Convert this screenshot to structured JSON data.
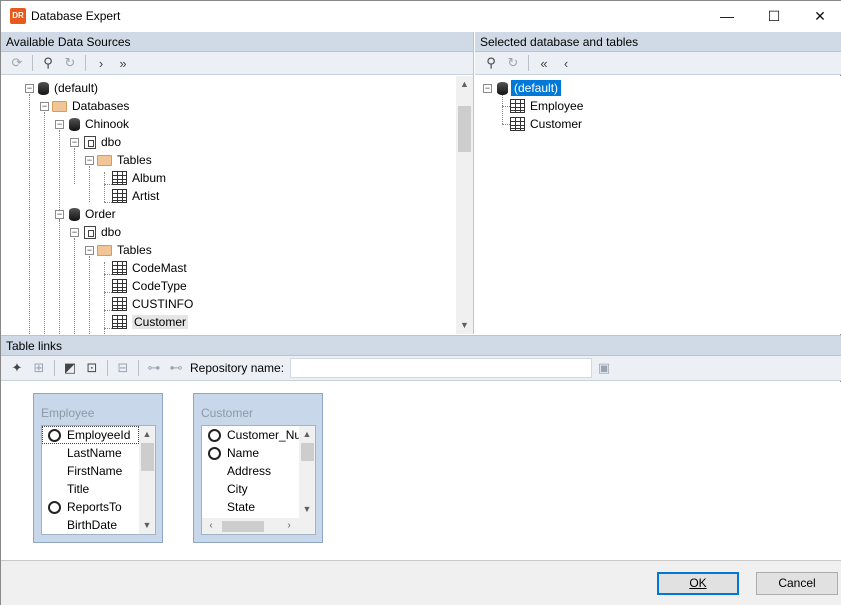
{
  "window": {
    "title": "Database Expert",
    "app_icon_text": "DR",
    "minimize_glyph": "—",
    "maximize_glyph": "☐",
    "close_glyph": "✕"
  },
  "available_pane": {
    "header": "Available Data Sources",
    "toolbar_icons": [
      "refresh-icon",
      "find-icon",
      "find-next-icon",
      "add-icon",
      "add-all-icon"
    ],
    "tree": {
      "root": "(default)",
      "databases": "Databases",
      "db1": "Chinook",
      "db1_schema": "dbo",
      "db1_tables": "Tables",
      "db1_table_1": "Album",
      "db1_table_2": "Artist",
      "db2": "Order",
      "db2_schema": "dbo",
      "db2_tables": "Tables",
      "db2_table_1": "CodeMast",
      "db2_table_2": "CodeType",
      "db2_table_3": "CUSTINFO",
      "db2_table_4": "Customer"
    }
  },
  "selected_pane": {
    "header": "Selected database and tables",
    "toolbar_icons": [
      "find-icon",
      "find-next-icon",
      "remove-all-icon",
      "remove-icon"
    ],
    "tree": {
      "root": "(default)",
      "table_1": "Employee",
      "table_2": "Customer"
    }
  },
  "links_pane": {
    "header": "Table links",
    "repository_label": "Repository name:",
    "repository_value": "",
    "tables": [
      {
        "name": "Employee",
        "fields": [
          "EmployeeId",
          "LastName",
          "FirstName",
          "Title",
          "ReportsTo",
          "BirthDate"
        ],
        "key_fields": [
          "EmployeeId",
          "ReportsTo"
        ]
      },
      {
        "name": "Customer",
        "fields": [
          "Customer_Nu",
          "Name",
          "Address",
          "City",
          "State"
        ],
        "key_fields": [
          "Customer_Nu",
          "Name"
        ]
      }
    ]
  },
  "buttons": {
    "ok": "OK",
    "cancel": "Cancel"
  },
  "colors": {
    "pane_header": "#cfdae6",
    "toolbar": "#ecf0f5",
    "selection": "#0078d7",
    "table_box": "#c8d8ea"
  }
}
